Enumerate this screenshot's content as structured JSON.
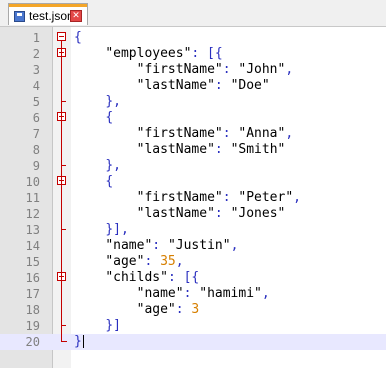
{
  "tab": {
    "label": "test.json",
    "close_glyph": "✕"
  },
  "colors": {
    "punctuation": "#2a2fbf",
    "number": "#d67f00",
    "fold": "#c40000",
    "tab_accent": "#f4a629",
    "current_line": "#e8e8ff"
  },
  "editor": {
    "lines": [
      {
        "n": "1",
        "fold": "open",
        "tokens": [
          [
            "p",
            "{"
          ]
        ]
      },
      {
        "n": "2",
        "fold": "open",
        "tokens": [
          [
            "t",
            "    "
          ],
          [
            "k",
            "\"employees\""
          ],
          [
            "p",
            ": [{"
          ]
        ]
      },
      {
        "n": "3",
        "tokens": [
          [
            "t",
            "        "
          ],
          [
            "k",
            "\"firstName\""
          ],
          [
            "p",
            ": "
          ],
          [
            "s",
            "\"John\""
          ],
          [
            "p",
            ","
          ]
        ]
      },
      {
        "n": "4",
        "tokens": [
          [
            "t",
            "        "
          ],
          [
            "k",
            "\"lastName\""
          ],
          [
            "p",
            ": "
          ],
          [
            "s",
            "\"Doe\""
          ]
        ]
      },
      {
        "n": "5",
        "tokens": [
          [
            "t",
            "    "
          ],
          [
            "p",
            "},"
          ]
        ]
      },
      {
        "n": "6",
        "fold": "open",
        "tokens": [
          [
            "t",
            "    "
          ],
          [
            "p",
            "{"
          ]
        ]
      },
      {
        "n": "7",
        "tokens": [
          [
            "t",
            "        "
          ],
          [
            "k",
            "\"firstName\""
          ],
          [
            "p",
            ": "
          ],
          [
            "s",
            "\"Anna\""
          ],
          [
            "p",
            ","
          ]
        ]
      },
      {
        "n": "8",
        "tokens": [
          [
            "t",
            "        "
          ],
          [
            "k",
            "\"lastName\""
          ],
          [
            "p",
            ": "
          ],
          [
            "s",
            "\"Smith\""
          ]
        ]
      },
      {
        "n": "9",
        "tokens": [
          [
            "t",
            "    "
          ],
          [
            "p",
            "},"
          ]
        ]
      },
      {
        "n": "10",
        "fold": "open",
        "tokens": [
          [
            "t",
            "    "
          ],
          [
            "p",
            "{"
          ]
        ]
      },
      {
        "n": "11",
        "tokens": [
          [
            "t",
            "        "
          ],
          [
            "k",
            "\"firstName\""
          ],
          [
            "p",
            ": "
          ],
          [
            "s",
            "\"Peter\""
          ],
          [
            "p",
            ","
          ]
        ]
      },
      {
        "n": "12",
        "tokens": [
          [
            "t",
            "        "
          ],
          [
            "k",
            "\"lastName\""
          ],
          [
            "p",
            ": "
          ],
          [
            "s",
            "\"Jones\""
          ]
        ]
      },
      {
        "n": "13",
        "tokens": [
          [
            "t",
            "    "
          ],
          [
            "p",
            "}],"
          ]
        ]
      },
      {
        "n": "14",
        "tokens": [
          [
            "t",
            "    "
          ],
          [
            "k",
            "\"name\""
          ],
          [
            "p",
            ": "
          ],
          [
            "s",
            "\"Justin\""
          ],
          [
            "p",
            ","
          ]
        ]
      },
      {
        "n": "15",
        "tokens": [
          [
            "t",
            "    "
          ],
          [
            "k",
            "\"age\""
          ],
          [
            "p",
            ": "
          ],
          [
            "n",
            "35"
          ],
          [
            "p",
            ","
          ]
        ]
      },
      {
        "n": "16",
        "fold": "open",
        "tokens": [
          [
            "t",
            "    "
          ],
          [
            "k",
            "\"childs\""
          ],
          [
            "p",
            ": [{"
          ]
        ]
      },
      {
        "n": "17",
        "tokens": [
          [
            "t",
            "        "
          ],
          [
            "k",
            "\"name\""
          ],
          [
            "p",
            ": "
          ],
          [
            "s",
            "\"hamimi\""
          ],
          [
            "p",
            ","
          ]
        ]
      },
      {
        "n": "18",
        "tokens": [
          [
            "t",
            "        "
          ],
          [
            "k",
            "\"age\""
          ],
          [
            "p",
            ": "
          ],
          [
            "n",
            "3"
          ]
        ]
      },
      {
        "n": "19",
        "tokens": [
          [
            "t",
            "    "
          ],
          [
            "p",
            "}]"
          ]
        ]
      },
      {
        "n": "20",
        "current": true,
        "tokens": [
          [
            "p",
            "}"
          ]
        ]
      }
    ]
  }
}
